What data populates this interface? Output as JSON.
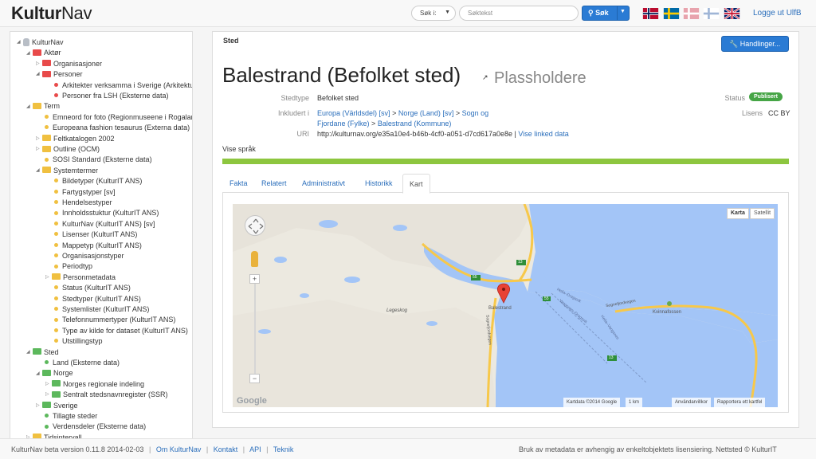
{
  "header": {
    "logo_bold": "Kultur",
    "logo_light": "Nav",
    "search_type_label": "Søk i:",
    "search_placeholder": "Søktekst",
    "search_button_label": "Søk",
    "logout_label": "Logge ut UlfB",
    "languages": [
      {
        "name": "flag-norway-icon",
        "colors": [
          "#ba0c2f",
          "#ffffff",
          "#00205b"
        ]
      },
      {
        "name": "flag-sweden-icon",
        "colors": [
          "#006aa7",
          "#fecc00"
        ]
      },
      {
        "name": "flag-denmark-icon",
        "colors": [
          "#c8102e",
          "#ffffff"
        ]
      },
      {
        "name": "flag-finland-icon",
        "colors": [
          "#ffffff",
          "#003580"
        ]
      },
      {
        "name": "flag-uk-icon",
        "colors": [
          "#012169",
          "#ffffff",
          "#c8102e"
        ]
      }
    ]
  },
  "sidebar": {
    "items": [
      {
        "label": "KulturNav",
        "level": 0,
        "toggle": "open",
        "icon": "db"
      },
      {
        "label": "Aktør",
        "level": 1,
        "toggle": "open",
        "icon": "folder-red"
      },
      {
        "label": "Organisasjoner",
        "level": 2,
        "toggle": "closed",
        "icon": "folder-red"
      },
      {
        "label": "Personer",
        "level": 2,
        "toggle": "open",
        "icon": "folder-red"
      },
      {
        "label": "Arkitekter verksamma i Sverige (Arkitektur- och designcentrum)",
        "level": 3,
        "toggle": "none",
        "icon": "dot-red"
      },
      {
        "label": "Personer fra LSH (Eksterne data)",
        "level": 3,
        "toggle": "none",
        "icon": "dot-red"
      },
      {
        "label": "Term",
        "level": 1,
        "toggle": "open",
        "icon": "folder-yellow"
      },
      {
        "label": "Emneord for foto (Regionmuseene i Rogaland)",
        "level": 2,
        "toggle": "none",
        "icon": "dot-yellow"
      },
      {
        "label": "Europeana fashion tesaurus (Externa data)",
        "level": 2,
        "toggle": "none",
        "icon": "dot-yellow"
      },
      {
        "label": "Feltkatalogen 2002",
        "level": 2,
        "toggle": "closed",
        "icon": "folder-yellow"
      },
      {
        "label": "Outline (OCM)",
        "level": 2,
        "toggle": "closed",
        "icon": "folder-yellow"
      },
      {
        "label": "SOSI Standard (Eksterne data)",
        "level": 2,
        "toggle": "none",
        "icon": "dot-yellow"
      },
      {
        "label": "Systemtermer",
        "level": 2,
        "toggle": "open",
        "icon": "folder-yellow"
      },
      {
        "label": "Bildetyper (KulturIT ANS)",
        "level": 3,
        "toggle": "none",
        "icon": "dot-yellow"
      },
      {
        "label": "Fartygstyper [sv]",
        "level": 3,
        "toggle": "none",
        "icon": "dot-yellow"
      },
      {
        "label": "Hendelsestyper",
        "level": 3,
        "toggle": "none",
        "icon": "dot-yellow"
      },
      {
        "label": "Innholdsstuktur (KulturIT ANS)",
        "level": 3,
        "toggle": "none",
        "icon": "dot-yellow"
      },
      {
        "label": "KulturNav (KulturIT ANS) [sv]",
        "level": 3,
        "toggle": "none",
        "icon": "dot-yellow"
      },
      {
        "label": "Lisenser (KulturIT ANS)",
        "level": 3,
        "toggle": "none",
        "icon": "dot-yellow"
      },
      {
        "label": "Mappetyp (KulturIT ANS)",
        "level": 3,
        "toggle": "none",
        "icon": "dot-yellow"
      },
      {
        "label": "Organisasjonstyper",
        "level": 3,
        "toggle": "none",
        "icon": "dot-yellow"
      },
      {
        "label": "Periodtyp",
        "level": 3,
        "toggle": "none",
        "icon": "dot-yellow"
      },
      {
        "label": "Personmetadata",
        "level": 3,
        "toggle": "closed",
        "icon": "folder-yellow"
      },
      {
        "label": "Status (KulturIT ANS)",
        "level": 3,
        "toggle": "none",
        "icon": "dot-yellow"
      },
      {
        "label": "Stedtyper (KulturIT ANS)",
        "level": 3,
        "toggle": "none",
        "icon": "dot-yellow"
      },
      {
        "label": "Systemlister (KulturIT ANS)",
        "level": 3,
        "toggle": "none",
        "icon": "dot-yellow"
      },
      {
        "label": "Telefonnummertyper (KulturIT ANS)",
        "level": 3,
        "toggle": "none",
        "icon": "dot-yellow"
      },
      {
        "label": "Type av kilde for dataset (KulturIT ANS)",
        "level": 3,
        "toggle": "none",
        "icon": "dot-yellow"
      },
      {
        "label": "Utstillingstyp",
        "level": 3,
        "toggle": "none",
        "icon": "dot-yellow"
      },
      {
        "label": "Sted",
        "level": 1,
        "toggle": "open",
        "icon": "folder-green"
      },
      {
        "label": "Land (Eksterne data)",
        "level": 2,
        "toggle": "none",
        "icon": "dot-green"
      },
      {
        "label": "Norge",
        "level": 2,
        "toggle": "open",
        "icon": "folder-green"
      },
      {
        "label": "Norges regionale indeling",
        "level": 3,
        "toggle": "closed",
        "icon": "folder-green"
      },
      {
        "label": "Sentralt stedsnavnregister (SSR)",
        "level": 3,
        "toggle": "closed",
        "icon": "folder-green"
      },
      {
        "label": "Sverige",
        "level": 2,
        "toggle": "closed",
        "icon": "folder-green"
      },
      {
        "label": "Tillagte steder",
        "level": 2,
        "toggle": "none",
        "icon": "dot-green"
      },
      {
        "label": "Verdensdeler (Eksterne data)",
        "level": 2,
        "toggle": "none",
        "icon": "dot-green"
      },
      {
        "label": "Tidsintervall",
        "level": 1,
        "toggle": "closed",
        "icon": "folder-yellow"
      }
    ]
  },
  "main": {
    "type_label": "Sted",
    "actions_label": "Handlinger...",
    "title": "Balestrand (Befolket sted)",
    "placeholder_text": "Plassholdere",
    "fields": {
      "stedtype_label": "Stedtype",
      "stedtype_value": "Befolket sted",
      "inkludert_label": "Inkludert i",
      "inkludert_line1": [
        "Europa (Världsdel) [sv]",
        "Norge (Land) [sv]",
        "Sogn og"
      ],
      "inkludert_line2": [
        "Fjordane (Fylke)",
        "Balestrand (Kommune)"
      ],
      "uri_label": "URI",
      "uri_value": "http://kulturnav.org/e35a10e4-b46b-4cf0-a051-d7cd617a0e8e",
      "uri_link": "Vise linked data",
      "status_label": "Status",
      "status_value": "Publisert",
      "license_label": "Lisens",
      "license_value": "CC BY"
    },
    "show_languages": "Vise språk",
    "tabs": [
      "Fakta",
      "Relatert",
      "Administrativt",
      "Historikk",
      "Kart"
    ],
    "active_tab": 4
  },
  "map": {
    "type_buttons": [
      "Karta",
      "Satellit"
    ],
    "labels": {
      "balestrand": "Balestrand",
      "legeskog": "Legeskog",
      "kvinnafossen": "Kvinnafossen",
      "road_55a": "55",
      "road_55b": "55",
      "road_13a": "13",
      "road_13b": "13",
      "ferry1": "Hella–Dragsvik",
      "ferry2": "Vangsnes–Dragsvik",
      "ferry3": "Hella–Vangsnes",
      "road_name1": "Sognefjordvegen",
      "road_name2": "Sognefjordvegen"
    },
    "footer_attribution": "Kartdata ©2014 Google",
    "footer_scale": "1 km",
    "footer_terms": "Användarvillkor",
    "footer_report": "Rapportera ett kartfel",
    "google_logo": "Google",
    "colors": {
      "water": "#a3c5f7",
      "land": "#f0ede5",
      "road": "#f7c84a"
    }
  },
  "footer": {
    "version": "KulturNav beta version 0.11.8 2014-02-03",
    "links": [
      "Om KulturNav",
      "Kontakt",
      "API",
      "Teknik"
    ],
    "right_text": "Bruk av metadata er avhengig av enkeltobjektets lisensiering. Nettsted © KulturIT"
  }
}
